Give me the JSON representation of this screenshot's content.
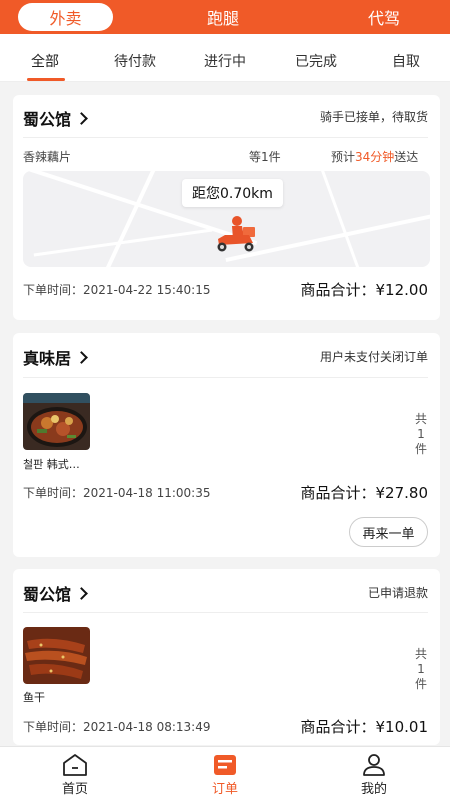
{
  "top_tabs": {
    "active": "外卖",
    "paotui": "跑腿",
    "daijia": "代驾"
  },
  "order_tabs": [
    "全部",
    "待付款",
    "进行中",
    "已完成",
    "自取"
  ],
  "orders": [
    {
      "shop": "蜀公馆",
      "status": "骑手已接单，待取货",
      "item": "香辣藕片",
      "qty": "等1件",
      "eta_prefix": "预计",
      "eta_time": "34分钟",
      "eta_suffix": "送达",
      "distance": "距您0.70km",
      "time_label": "下单时间：",
      "time": "2021-04-22 15:40:15",
      "total_label": "商品合计：",
      "total": "¥12.00"
    },
    {
      "shop": "真味居",
      "status": "用户未支付关闭订单",
      "item": "철판 韩式…",
      "count_chars": [
        "共",
        "1",
        "件"
      ],
      "time_label": "下单时间：",
      "time": "2021-04-18 11:00:35",
      "total_label": "商品合计：",
      "total": "¥27.80",
      "reorder": "再来一单"
    },
    {
      "shop": "蜀公馆",
      "status": "已申请退款",
      "item": "鱼干",
      "count_chars": [
        "共",
        "1",
        "件"
      ],
      "time_label": "下单时间：",
      "time": "2021-04-18 08:13:49",
      "total_label": "商品合计：",
      "total": "¥10.01"
    }
  ],
  "bottom_nav": {
    "home": "首页",
    "orders": "订单",
    "mine": "我的"
  },
  "icons": {
    "home": "home-icon",
    "orders": "orders-icon",
    "mine": "user-icon",
    "rider": "scooter-rider-icon",
    "chevron": "chevron-right-icon"
  },
  "colors": {
    "accent": "#f05a28"
  }
}
